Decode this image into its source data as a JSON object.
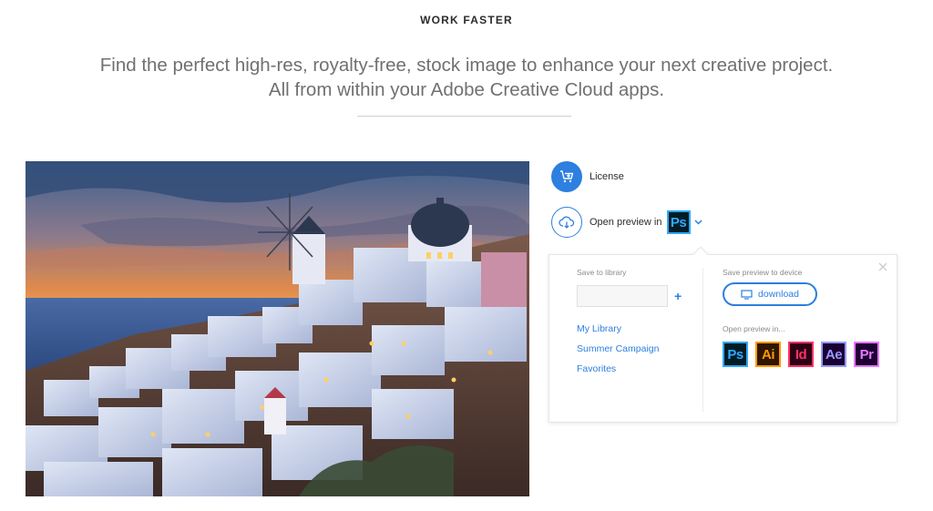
{
  "header": {
    "eyebrow": "WORK FASTER",
    "headline_line1": "Find the perfect high-res, royalty-free, stock image to enhance your next creative project.",
    "headline_line2": "All from within your Adobe Creative Cloud apps."
  },
  "actions": {
    "license_label": "License",
    "open_preview_label": "Open preview in",
    "current_app": "Ps"
  },
  "panel": {
    "save_to_library_label": "Save to library",
    "library_input_value": "",
    "add_label": "+",
    "libraries": [
      "My Library",
      "Summer Campaign",
      "Favorites"
    ],
    "save_preview_label": "Save preview to device",
    "download_label": "download",
    "open_preview_in_label": "Open preview in...",
    "apps": [
      {
        "abbr": "Ps",
        "bg": "#001d26",
        "fg": "#31a8ff"
      },
      {
        "abbr": "Ai",
        "bg": "#2e1600",
        "fg": "#ff9a00"
      },
      {
        "abbr": "Id",
        "bg": "#2d0015",
        "fg": "#ff3366"
      },
      {
        "abbr": "Ae",
        "bg": "#1a0033",
        "fg": "#9999ff"
      },
      {
        "abbr": "Pr",
        "bg": "#1e0033",
        "fg": "#e579ff"
      }
    ]
  },
  "colors": {
    "accent": "#2d7fe0"
  },
  "icons": {
    "license": "cart-plus-icon",
    "open_preview": "cloud-download-icon",
    "dropdown": "chevron-down-icon",
    "close": "close-icon",
    "download": "monitor-icon"
  }
}
